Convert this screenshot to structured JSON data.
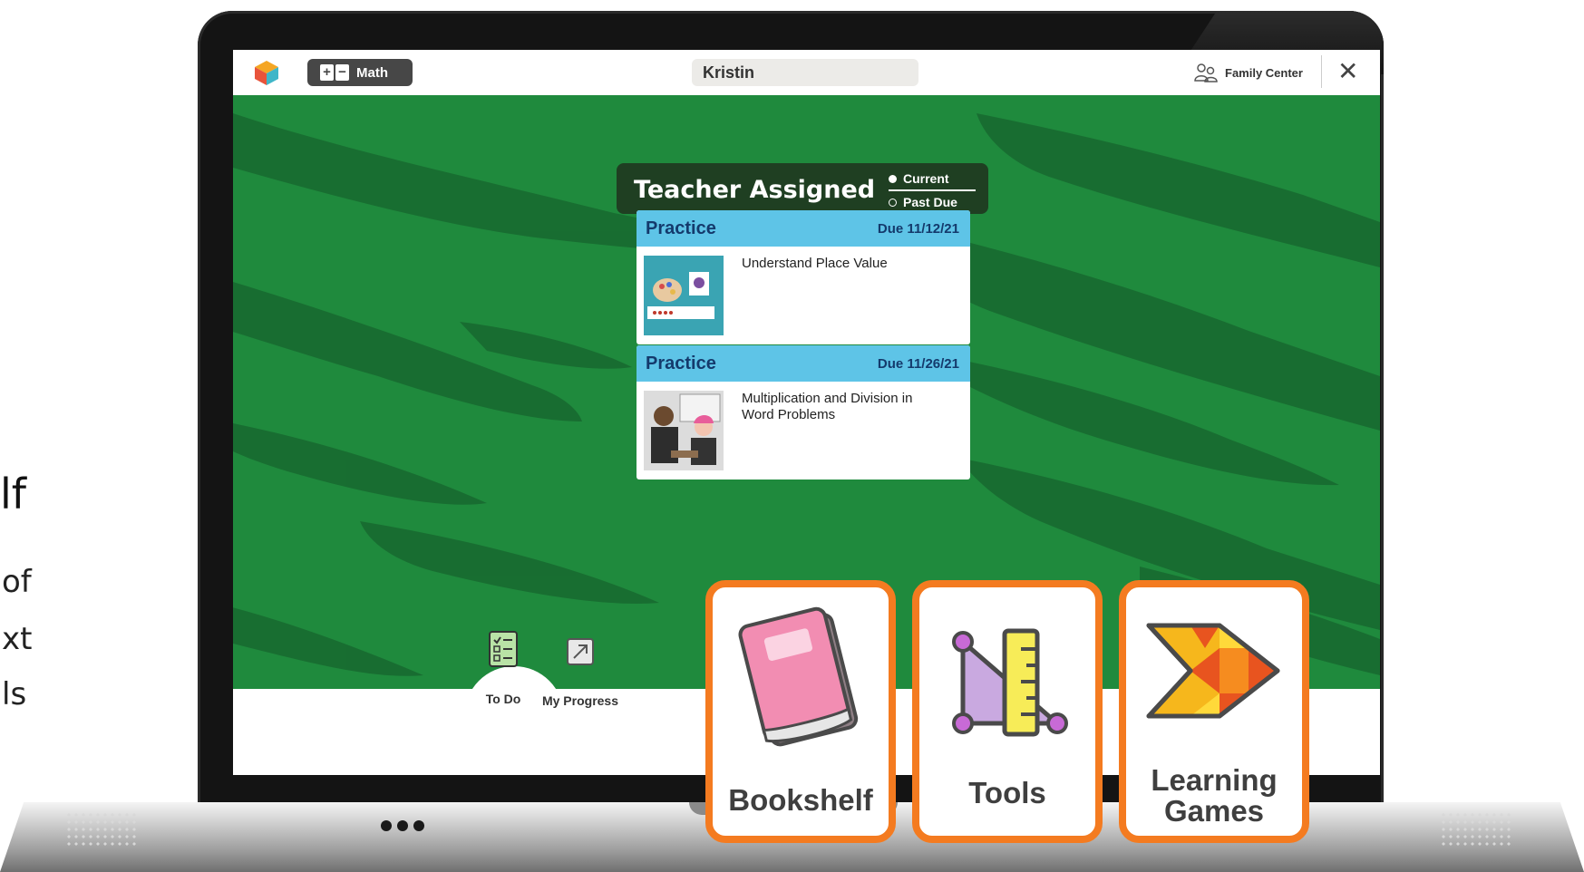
{
  "slide_fragment": {
    "title_tail": "lf",
    "lines": [
      "of",
      "xt",
      "ls"
    ]
  },
  "app": {
    "subject": "Math",
    "student_name": "Kristin",
    "family_center": "Family Center",
    "close_symbol": "✕"
  },
  "assignments": {
    "heading": "Teacher Assigned",
    "legend_current": "Current",
    "legend_past_due": "Past Due",
    "items": [
      {
        "type": "Practice",
        "due": "Due 11/12/21",
        "title": "Understand Place Value"
      },
      {
        "type": "Practice",
        "due": "Due 11/26/21",
        "title": "Multiplication and Division in Word Problems"
      }
    ]
  },
  "nav": {
    "tabs": [
      {
        "label": "To Do",
        "icon": "checklist-icon"
      },
      {
        "label": "My Progress",
        "icon": "progress-arrow-icon"
      }
    ]
  },
  "features": [
    {
      "label": "Bookshelf",
      "icon": "book-icon"
    },
    {
      "label": "Tools",
      "icon": "ruler-triangle-icon"
    },
    {
      "label_line1": "Learning",
      "label_line2": "Games",
      "icon": "games-arrow-icon"
    }
  ],
  "colors": {
    "background_green": "#1f8a3d",
    "card_header_blue": "#5ec4e7",
    "tile_border_orange": "#f47b20",
    "heading_dark": "#1f3f22"
  }
}
